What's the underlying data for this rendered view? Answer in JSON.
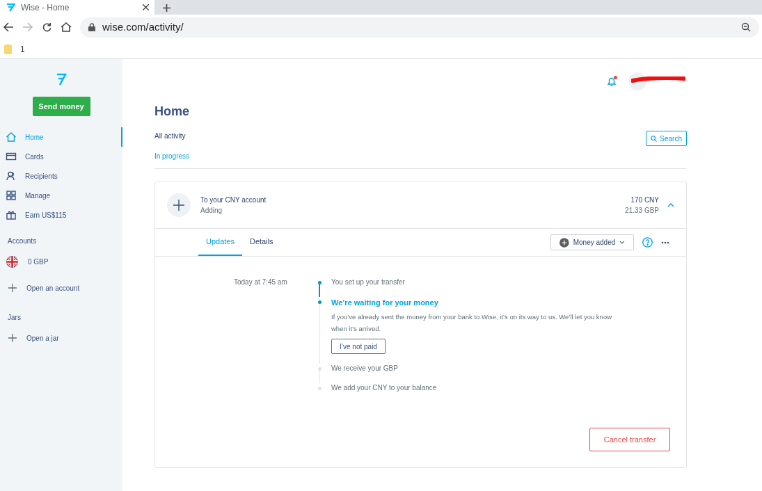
{
  "browser": {
    "tab_title": "Wise - Home",
    "url": "wise.com/activity/",
    "bookmarks": [
      "1"
    ]
  },
  "sidebar": {
    "send_button": "Send money",
    "nav": [
      {
        "label": "Home",
        "kind": "home",
        "selected": true
      },
      {
        "label": "Cards",
        "kind": "card",
        "selected": false
      },
      {
        "label": "Recipients",
        "kind": "people",
        "selected": false
      },
      {
        "label": "Manage",
        "kind": "grid",
        "selected": false
      },
      {
        "label": "Earn US$115",
        "kind": "gift",
        "selected": false
      }
    ],
    "sections": [
      {
        "title": "Accounts",
        "items": [
          {
            "kind": "flag",
            "label": "0 GBP"
          },
          {
            "kind": "add",
            "label": "Open an account"
          }
        ]
      },
      {
        "title": "Jars",
        "items": [
          {
            "kind": "add",
            "label": "Open a jar"
          }
        ]
      }
    ]
  },
  "header": {
    "notifications": true
  },
  "page": {
    "title": "Home",
    "filters": [
      {
        "label": "All activity",
        "selected": false
      },
      {
        "label": "In progress",
        "selected": true
      }
    ],
    "search_button": "Search"
  },
  "transfer": {
    "title": "To your CNY account",
    "status": "Adding",
    "amount": "170 CNY",
    "amount_source": "21.33 GBP",
    "expanded": true,
    "tabs": [
      {
        "label": "Updates",
        "selected": true
      },
      {
        "label": "Details",
        "selected": false
      }
    ],
    "stage_dropdown": "Money added",
    "timestamp": "Today at 7:45 am",
    "steps": [
      {
        "kind": "done",
        "title": "You set up your transfer"
      },
      {
        "kind": "current",
        "title": "We’re waiting for your money",
        "text": "If you’ve already sent the money from your bank to Wise, it’s on its way to us. We’ll let you know when it’s arrived.",
        "button": "I’ve not paid"
      },
      {
        "kind": "pending",
        "title": "We receive your GBP"
      },
      {
        "kind": "pending",
        "title": "We add your CNY to your balance"
      }
    ],
    "cancel_button": "Cancel transfer"
  }
}
